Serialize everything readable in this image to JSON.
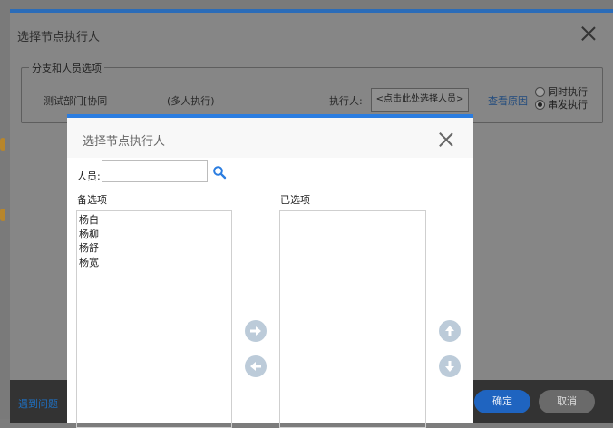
{
  "outer": {
    "title": "选择节点执行人",
    "fieldset_legend": "分支和人员选项",
    "node_name": "测试部门[协同",
    "mode_text": "(多人执行)",
    "executor_label": "执行人:",
    "executor_button": "<点击此处选择人员>",
    "reason_link": "查看原因",
    "radio_options": [
      {
        "label": "同时执行",
        "checked": false
      },
      {
        "label": "串发执行",
        "checked": true
      }
    ],
    "footer_link": "遇到问题",
    "ok_label": "确定",
    "cancel_label": "取消"
  },
  "inner": {
    "title": "选择节点执行人",
    "person_label": "人员:",
    "person_value": "",
    "candidates_label": "备选项",
    "selected_label": "已选项",
    "candidates": [
      "杨白",
      "杨柳",
      "杨舒",
      "杨宽"
    ],
    "selected": []
  },
  "colors": {
    "accent": "#2b7de0",
    "ok_button": "#1f64c0",
    "overlay": "#868686",
    "arrow_button": "#bccbd9"
  }
}
